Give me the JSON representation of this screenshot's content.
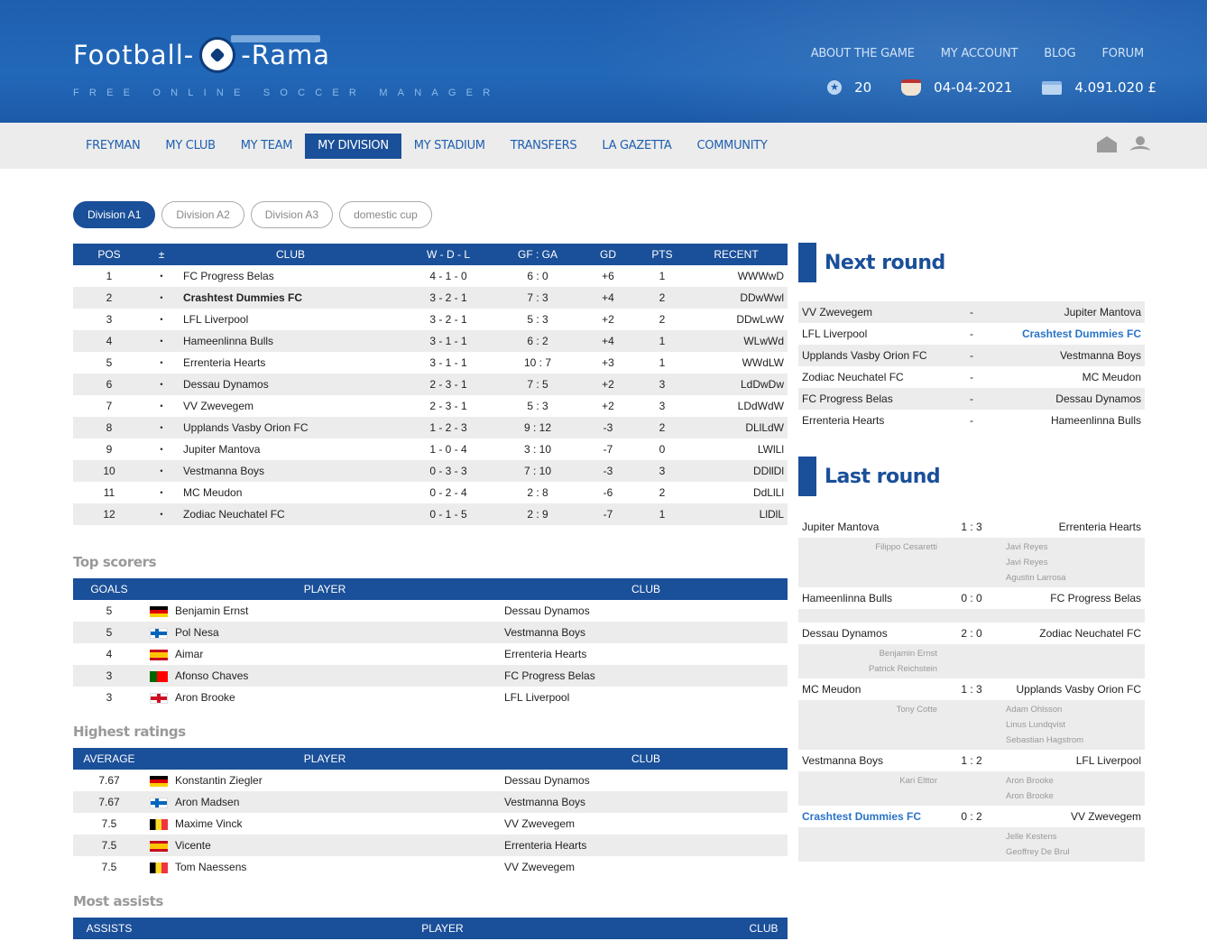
{
  "header": {
    "logo_text_left": "Football-",
    "logo_text_right": "-Rama",
    "tagline": "FREE ONLINE SOCCER MANAGER",
    "top_links": [
      "ABOUT THE GAME",
      "MY ACCOUNT",
      "BLOG",
      "FORUM"
    ],
    "stat_points": "20",
    "stat_date": "04-04-2021",
    "stat_money": "4.091.020 £"
  },
  "nav": {
    "items": [
      "FREYMAN",
      "MY CLUB",
      "MY TEAM",
      "MY DIVISION",
      "MY STADIUM",
      "TRANSFERS",
      "LA GAZETTA",
      "COMMUNITY"
    ],
    "active_index": 3
  },
  "division_tabs": [
    "Division A1",
    "Division A2",
    "Division A3",
    "domestic cup"
  ],
  "standings": {
    "headers": [
      "POS",
      "±",
      "CLUB",
      "W - D - L",
      "GF : GA",
      "GD",
      "PTS",
      "RECENT"
    ],
    "rows": [
      [
        "1",
        "•",
        "FC Progress Belas",
        "4 - 1 - 0",
        "6 : 0",
        "+6",
        "1",
        "WWWwD"
      ],
      [
        "2",
        "•",
        "Crashtest Dummies FC",
        "3 - 2 - 1",
        "7 : 3",
        "+4",
        "2",
        "DDwWwl"
      ],
      [
        "3",
        "•",
        "LFL Liverpool",
        "3 - 2 - 1",
        "5 : 3",
        "+2",
        "2",
        "DDwLwW"
      ],
      [
        "4",
        "•",
        "Hameenlinna Bulls",
        "3 - 1 - 1",
        "6 : 2",
        "+4",
        "1",
        "WLwWd"
      ],
      [
        "5",
        "•",
        "Errenteria Hearts",
        "3 - 1 - 1",
        "10 : 7",
        "+3",
        "1",
        "WWdLW"
      ],
      [
        "6",
        "•",
        "Dessau Dynamos",
        "2 - 3 - 1",
        "7 : 5",
        "+2",
        "3",
        "LdDwDw"
      ],
      [
        "7",
        "•",
        "VV Zwevegem",
        "2 - 3 - 1",
        "5 : 3",
        "+2",
        "3",
        "LDdWdW"
      ],
      [
        "8",
        "•",
        "Upplands Vasby Orion FC",
        "1 - 2 - 3",
        "9 : 12",
        "-3",
        "2",
        "DLlLdW"
      ],
      [
        "9",
        "•",
        "Jupiter Mantova",
        "1 - 0 - 4",
        "3 : 10",
        "-7",
        "0",
        "LWlLl"
      ],
      [
        "10",
        "•",
        "Vestmanna Boys",
        "0 - 3 - 3",
        "7 : 10",
        "-3",
        "3",
        "DDllDl"
      ],
      [
        "11",
        "•",
        "MC Meudon",
        "0 - 2 - 4",
        "2 : 8",
        "-6",
        "2",
        "DdLlLl"
      ],
      [
        "12",
        "•",
        "Zodiac Neuchatel FC",
        "0 - 1 - 5",
        "2 : 9",
        "-7",
        "1",
        "LlDlL"
      ]
    ],
    "own_club_index": 1
  },
  "top_scorers": {
    "title": "Top scorers",
    "headers": [
      "GOALS",
      "PLAYER",
      "CLUB"
    ],
    "rows": [
      {
        "value": "5",
        "flag": "de",
        "player": "Benjamin Ernst",
        "club": "Dessau Dynamos"
      },
      {
        "value": "5",
        "flag": "fo",
        "player": "Pol Nesa",
        "club": "Vestmanna Boys"
      },
      {
        "value": "4",
        "flag": "es",
        "player": "Aimar",
        "club": "Errenteria Hearts"
      },
      {
        "value": "3",
        "flag": "pt",
        "player": "Afonso Chaves",
        "club": "FC Progress Belas"
      },
      {
        "value": "3",
        "flag": "en",
        "player": "Aron Brooke",
        "club": "LFL Liverpool"
      }
    ]
  },
  "highest_ratings": {
    "title": "Highest ratings",
    "headers": [
      "AVERAGE",
      "PLAYER",
      "CLUB"
    ],
    "rows": [
      {
        "value": "7.67",
        "flag": "de",
        "player": "Konstantin Ziegler",
        "club": "Dessau Dynamos"
      },
      {
        "value": "7.67",
        "flag": "fo",
        "player": "Aron Madsen",
        "club": "Vestmanna Boys"
      },
      {
        "value": "7.5",
        "flag": "be",
        "player": "Maxime Vinck",
        "club": "VV Zwevegem"
      },
      {
        "value": "7.5",
        "flag": "es",
        "player": "Vicente",
        "club": "Errenteria Hearts"
      },
      {
        "value": "7.5",
        "flag": "be",
        "player": "Tom Naessens",
        "club": "VV Zwevegem"
      }
    ]
  },
  "most_assists": {
    "title": "Most assists",
    "headers": [
      "ASSISTS",
      "PLAYER",
      "CLUB"
    ]
  },
  "next_round": {
    "title": "Next round",
    "matches": [
      {
        "home": "VV Zwevegem",
        "sep": "-",
        "away": "Jupiter Mantova"
      },
      {
        "home": "LFL Liverpool",
        "sep": "-",
        "away": "Crashtest Dummies FC"
      },
      {
        "home": "Upplands Vasby Orion FC",
        "sep": "-",
        "away": "Vestmanna Boys"
      },
      {
        "home": "Zodiac Neuchatel FC",
        "sep": "-",
        "away": "MC Meudon"
      },
      {
        "home": "FC Progress Belas",
        "sep": "-",
        "away": "Dessau Dynamos"
      },
      {
        "home": "Errenteria Hearts",
        "sep": "-",
        "away": "Hameenlinna Bulls"
      }
    ]
  },
  "last_round": {
    "title": "Last round",
    "matches": [
      {
        "home": "Jupiter Mantova",
        "score": "1 : 3",
        "away": "Errenteria Hearts",
        "home_scorers": [
          "Filippo Cesaretti"
        ],
        "away_scorers": [
          "Javi Reyes",
          "Javi Reyes",
          "Agustin Larrosa"
        ]
      },
      {
        "home": "Hameenlinna Bulls",
        "score": "0 : 0",
        "away": "FC Progress Belas",
        "home_scorers": [],
        "away_scorers": []
      },
      {
        "home": "Dessau Dynamos",
        "score": "2 : 0",
        "away": "Zodiac Neuchatel FC",
        "home_scorers": [
          "Benjamin Ernst",
          "Patrick Reichstein"
        ],
        "away_scorers": []
      },
      {
        "home": "MC Meudon",
        "score": "1 : 3",
        "away": "Upplands Vasby Orion FC",
        "home_scorers": [
          "Tony Cotte"
        ],
        "away_scorers": [
          "Adam Ohlsson",
          "Linus Lundqvist",
          "Sebastian Hagstrom"
        ]
      },
      {
        "home": "Vestmanna Boys",
        "score": "1 : 2",
        "away": "LFL Liverpool",
        "home_scorers": [
          "Kari Elttor"
        ],
        "away_scorers": [
          "Aron Brooke",
          "Aron Brooke"
        ]
      },
      {
        "home": "Crashtest Dummies FC",
        "score": "0 : 2",
        "away": "VV Zwevegem",
        "home_scorers": [],
        "away_scorers": [
          "Jelle Kestens",
          "Geoffrey De Brul"
        ]
      }
    ]
  },
  "own_club": "Crashtest Dummies FC",
  "colors": {
    "primary": "#1a4f99",
    "header_bg": "#2268b8",
    "accent_link": "#2a74c8",
    "row_alt": "#ececec"
  },
  "icons": {
    "points": "star-badge-icon",
    "date": "coffee-cup-icon",
    "money": "credit-card-icon",
    "mail": "mail-icon",
    "logout": "logout-icon"
  }
}
